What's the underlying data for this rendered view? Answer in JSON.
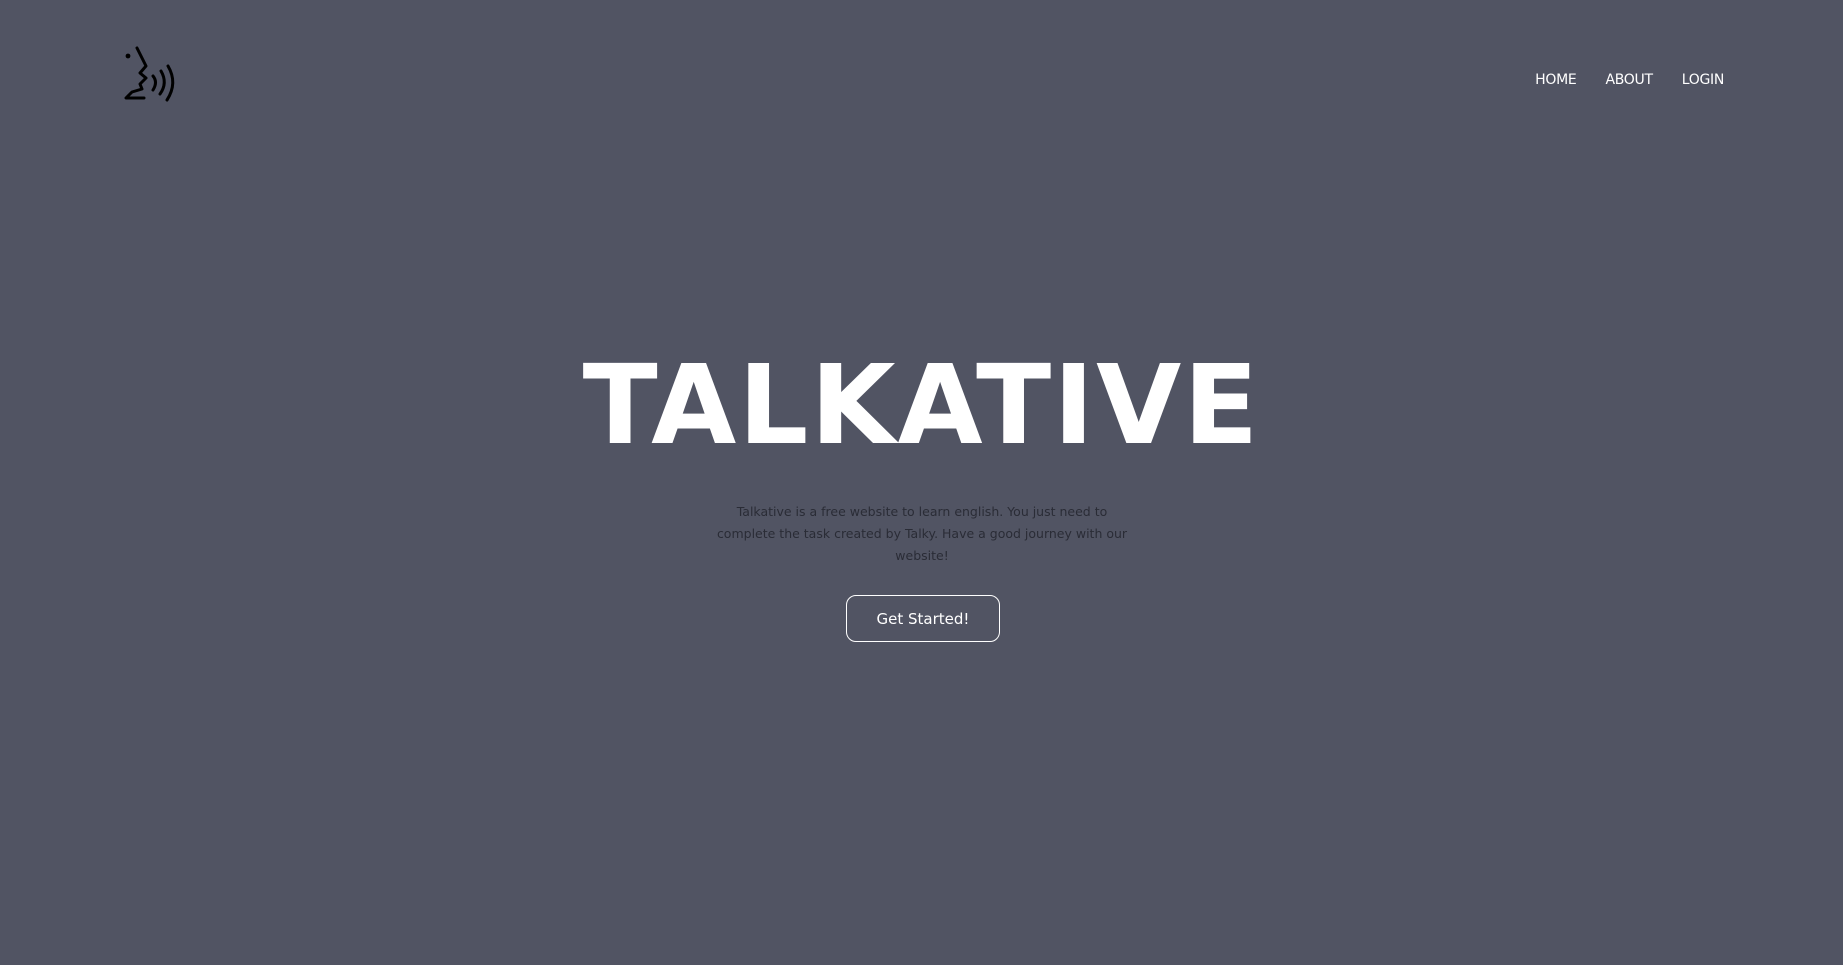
{
  "brand": {
    "logo_icon": "speaking-head-icon"
  },
  "nav": {
    "items": [
      {
        "label": "HOME"
      },
      {
        "label": "ABOUT"
      },
      {
        "label": "LOGIN"
      }
    ]
  },
  "hero": {
    "title": "TALKATIVE",
    "description": "Talkative is a free website to learn english. You just need to complete the task created by Talky. Have a good journey with our website!",
    "cta_label": "Get Started!"
  },
  "colors": {
    "background": "#515463",
    "text_primary": "#ffffff",
    "text_muted": "#2a2c36"
  }
}
